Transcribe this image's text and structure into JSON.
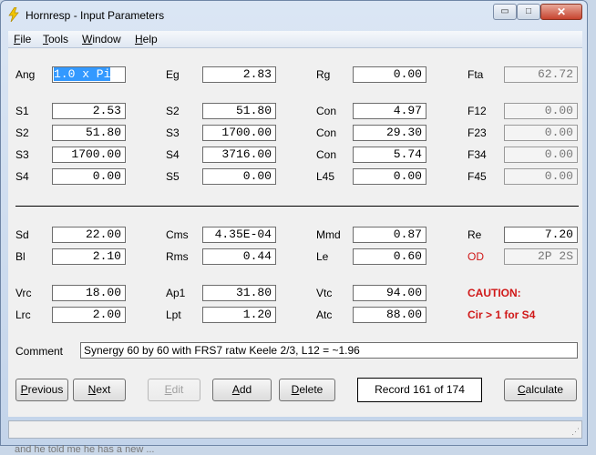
{
  "window": {
    "title": "Hornresp - Input Parameters",
    "controls": {
      "minimize": "▭",
      "maximize": "□",
      "close": "✕"
    }
  },
  "menu": {
    "file": "ile",
    "file_key": "F",
    "tools": "ools",
    "tools_key": "T",
    "window": "indow",
    "window_key": "W",
    "help": "elp",
    "help_key": "H"
  },
  "params": {
    "ang_label": "Ang",
    "ang": "1.0 x Pi",
    "eg_label": "Eg",
    "eg": "2.83",
    "rg_label": "Rg",
    "rg": "0.00",
    "fta_label": "Fta",
    "fta": "62.72",
    "s1_label": "S1",
    "s1": "2.53",
    "s2a_label": "S2",
    "s2a": "51.80",
    "con1_label": "Con",
    "con1": "4.97",
    "f12_label": "F12",
    "f12": "0.00",
    "s2b_label": "S2",
    "s2b": "51.80",
    "s3a_label": "S3",
    "s3a": "1700.00",
    "con2_label": "Con",
    "con2": "29.30",
    "f23_label": "F23",
    "f23": "0.00",
    "s3b_label": "S3",
    "s3b": "1700.00",
    "s4a_label": "S4",
    "s4a": "3716.00",
    "con3_label": "Con",
    "con3": "5.74",
    "f34_label": "F34",
    "f34": "0.00",
    "s4b_label": "S4",
    "s4b": "0.00",
    "s5_label": "S5",
    "s5": "0.00",
    "l45_label": "L45",
    "l45": "0.00",
    "f45_label": "F45",
    "f45": "0.00",
    "sd_label": "Sd",
    "sd": "22.00",
    "cms_label": "Cms",
    "cms": "4.35E-04",
    "mmd_label": "Mmd",
    "mmd": "0.87",
    "re_label": "Re",
    "re": "7.20",
    "bl_label": "Bl",
    "bl": "2.10",
    "rms_label": "Rms",
    "rms": "0.44",
    "le_label": "Le",
    "le": "0.60",
    "od_label": "OD",
    "od": "2P 2S",
    "vrc_label": "Vrc",
    "vrc": "18.00",
    "ap1_label": "Ap1",
    "ap1": "31.80",
    "vtc_label": "Vtc",
    "vtc": "94.00",
    "caution_label": "CAUTION:",
    "lrc_label": "Lrc",
    "lrc": "2.00",
    "lpt_label": "Lpt",
    "lpt": "1.20",
    "atc_label": "Atc",
    "atc": "88.00",
    "caution_msg": "Cir > 1 for S4"
  },
  "comment": {
    "label": "Comment",
    "value": "Synergy 60 by 60 with FRS7 ratw Keele 2/3, L12 = ~1.96"
  },
  "buttons": {
    "previous": "revious",
    "previous_key": "P",
    "next": "ext",
    "next_key": "N",
    "edit": "dit",
    "edit_key": "E",
    "add": "dd",
    "add_key": "A",
    "delete": "elete",
    "delete_key": "D",
    "record": "Record 161 of 174",
    "calculate": "alculate",
    "calculate_key": "C"
  },
  "behind_text": "and he told me he has a new ..."
}
